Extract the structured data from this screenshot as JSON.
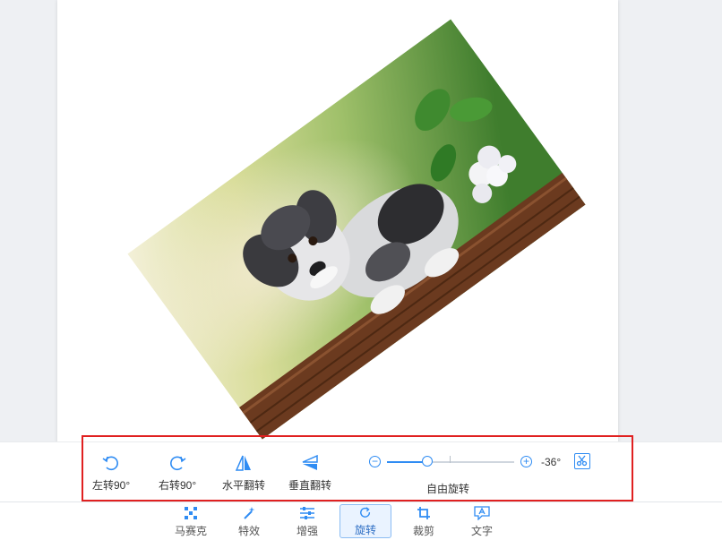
{
  "rotation_controls": {
    "rotate_left_label": "左转90°",
    "rotate_right_label": "右转90°",
    "flip_horizontal_label": "水平翻转",
    "flip_vertical_label": "垂直翻转",
    "free_rotate_label": "自由旋转",
    "angle_value": "-36°",
    "slider_fraction": 0.32
  },
  "toolbar": {
    "items": [
      {
        "label": "马赛克",
        "icon": "mosaic-icon"
      },
      {
        "label": "特效",
        "icon": "magic-wand-icon"
      },
      {
        "label": "增强",
        "icon": "sliders-icon"
      },
      {
        "label": "旋转",
        "icon": "rotate-icon",
        "active": true
      },
      {
        "label": "裁剪",
        "icon": "crop-icon"
      },
      {
        "label": "文字",
        "icon": "text-icon"
      }
    ]
  },
  "colors": {
    "accent": "#2f8cf3",
    "highlight": "#e02020"
  }
}
